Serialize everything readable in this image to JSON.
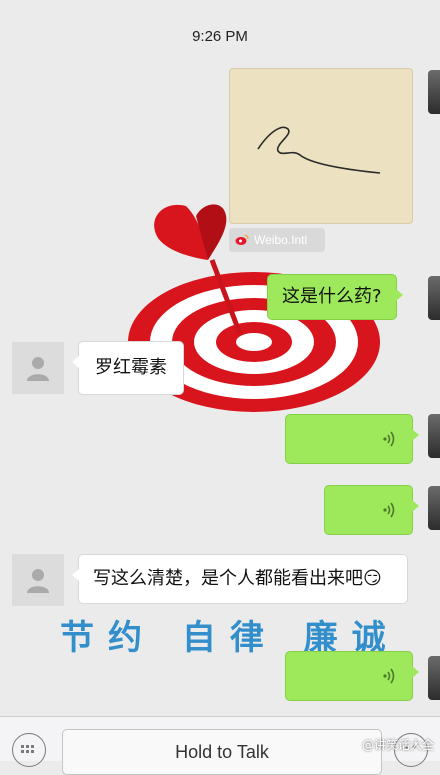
{
  "status": {
    "time": "9:26 PM"
  },
  "image_message": {
    "watermark": "Weibo.Intl"
  },
  "messages": [
    {
      "side": "right",
      "kind": "text",
      "text": "这是什么药?"
    },
    {
      "side": "left",
      "kind": "text",
      "text": "罗红霉素"
    },
    {
      "side": "right",
      "kind": "voice"
    },
    {
      "side": "right",
      "kind": "voice"
    },
    {
      "side": "left",
      "kind": "text",
      "text": "写这么清楚，是个人都能看出来吧😏"
    },
    {
      "side": "right",
      "kind": "voice"
    }
  ],
  "overlay_text": "节约 自律 廉诚",
  "input_bar": {
    "hold_label": "Hold to Talk"
  },
  "watermark_bottom": "@讲笑话大全",
  "colors": {
    "sent_bubble": "#9de95b",
    "received_bubble": "#ffffff",
    "background": "#ebebeb"
  }
}
